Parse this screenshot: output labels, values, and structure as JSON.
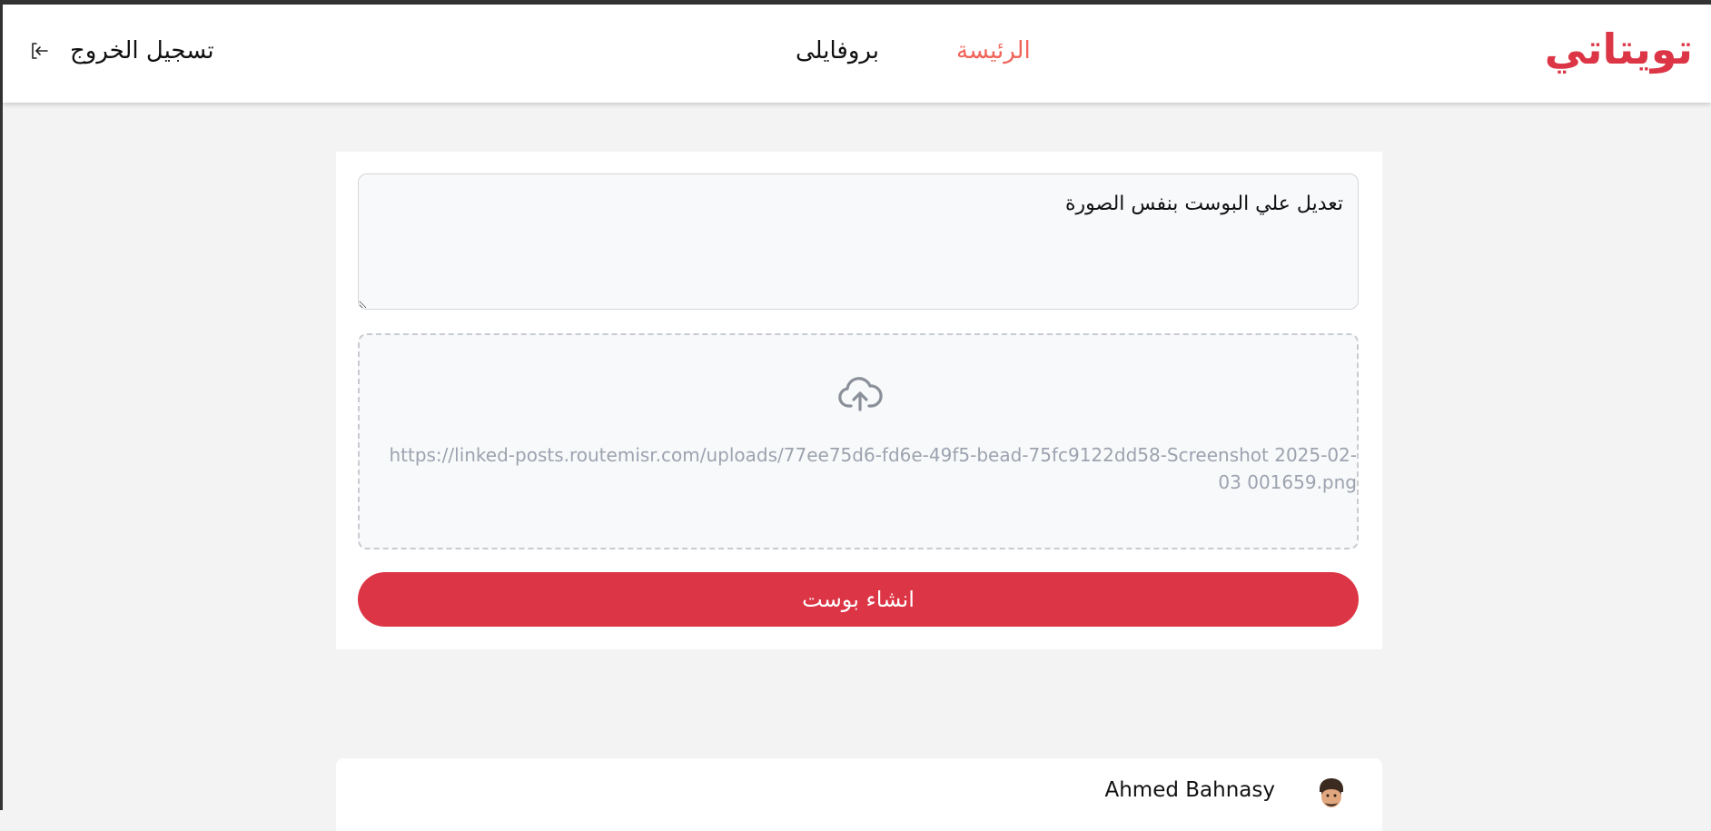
{
  "navbar": {
    "brand": "تويتاتي",
    "home_label": "الرئيسة",
    "profile_label": "بروفايلى",
    "logout_label": "تسجيل الخروج",
    "logout_icon": "logout-icon"
  },
  "composer": {
    "text_value": "تعديل علي البوست بنفس الصورة",
    "upload_icon": "cloud-upload-icon",
    "upload_file": "https://linked-posts.routemisr.com/uploads/77ee75d6-fd6e-49f5-bead-75fc9122dd58-Screenshot 2025-02-03 001659.png",
    "submit_label": "انشاء بوست"
  },
  "post": {
    "author_name": "Ahmed Bahnasy"
  },
  "colors": {
    "brand": "#dc3545",
    "active_link": "#f0645a",
    "button": "#dc3545"
  }
}
